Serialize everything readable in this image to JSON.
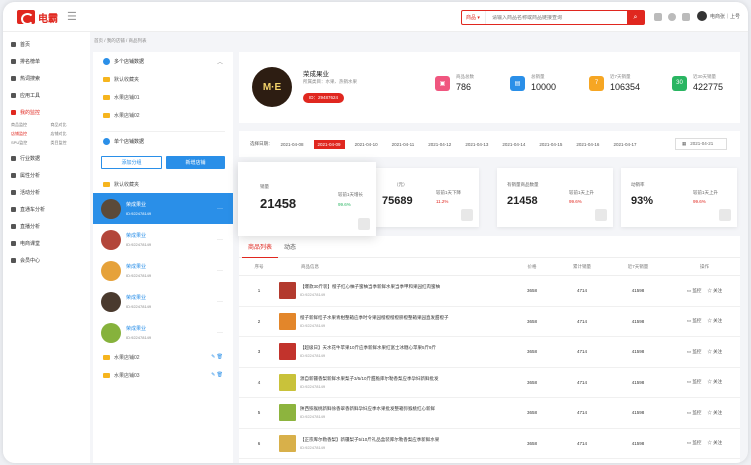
{
  "header": {
    "logo": "电霸",
    "menu_toggle": "☰",
    "search_category": "商品 ▾",
    "search_placeholder": "请输入商品名称或商品链接查询",
    "search_icon": "search-icon",
    "user_name": "电商张｜上号",
    "accent": "#e0271f"
  },
  "breadcrumb": "首页 / 我的店铺 / 商品列表",
  "sidebar": {
    "items": [
      {
        "label": "首页"
      },
      {
        "label": "排名榜单"
      },
      {
        "label": "热词搜索"
      },
      {
        "label": "应用工具"
      },
      {
        "label": "我的监控",
        "active": true
      }
    ],
    "sub": [
      "商品监控",
      "商品对比",
      "店铺监控",
      "店铺对比",
      "SPU监控",
      "类目监控"
    ],
    "items2": [
      {
        "label": "行业数据"
      },
      {
        "label": "属性分析"
      },
      {
        "label": "活动分析"
      },
      {
        "label": "直通车分析"
      },
      {
        "label": "直播分析"
      },
      {
        "label": "电商课堂"
      },
      {
        "label": "会员中心"
      }
    ]
  },
  "store_panel": {
    "group_multi": "多个店铺数据",
    "folders_top": [
      {
        "label": "默认收藏夹"
      },
      {
        "label": "水果店铺01"
      },
      {
        "label": "水果店铺02"
      }
    ],
    "group_single": "单个店铺数据",
    "btn_add_group": "添加分组",
    "btn_add_store": "新增店铺",
    "folder_default": "默认收藏夹",
    "stores": [
      {
        "name": "荣成果业",
        "id": "ID:922478149",
        "active": true
      },
      {
        "name": "荣成果业",
        "id": "ID:922478149"
      },
      {
        "name": "荣成果业",
        "id": "ID:922478149"
      },
      {
        "name": "荣成果业",
        "id": "ID:922478149"
      },
      {
        "name": "荣成果业",
        "id": "ID:922478149"
      }
    ],
    "folders_bottom": [
      {
        "label": "水果店铺02"
      },
      {
        "label": "水果店铺03"
      }
    ]
  },
  "shop": {
    "avatar_text": "M·E",
    "name": "荣成果业",
    "category": "所属类目：水果、热销水果",
    "id_badge": "ID：29487624",
    "kpis": [
      {
        "label": "商品总数",
        "value": "786",
        "color": "#f0567f",
        "icon": "cart-icon"
      },
      {
        "label": "总销量",
        "value": "10000",
        "color": "#2a8fe8",
        "icon": "chart-icon"
      },
      {
        "label": "近7天销量",
        "value": "106354",
        "color": "#f6a623",
        "icon": "seven-icon"
      },
      {
        "label": "近30天销量",
        "value": "422775",
        "color": "#2ab562",
        "icon": "thirty-icon"
      }
    ]
  },
  "datebar": {
    "label": "选择日期：",
    "dates": [
      "2021-04-08",
      "2021-04-09",
      "2021-04-10",
      "2021-04-11",
      "2021-04-12",
      "2021-04-13",
      "2021-04-14",
      "2021-04-15",
      "2021-04-16",
      "2021-04-17"
    ],
    "active_index": 1,
    "picker": "2021-04-21"
  },
  "stats": [
    {
      "label": "销量",
      "value": "21458",
      "cmp_label": "较前1天增长",
      "cmp_value": "99.6%",
      "cmp_color": "green"
    },
    {
      "label": "（元）",
      "value": "75689",
      "cmp_label": "较前1天下降",
      "cmp_value": "11.2%",
      "cmp_color": "red"
    },
    {
      "label": "有销量商品数量",
      "value": "21458",
      "cmp_label": "较前1天上升",
      "cmp_value": "99.6%",
      "cmp_color": "red"
    },
    {
      "label": "动销率",
      "value": "93%",
      "cmp_label": "较前1天上升",
      "cmp_value": "99.6%",
      "cmp_color": "red"
    }
  ],
  "tabs": [
    {
      "label": "商品列表",
      "active": true
    },
    {
      "label": "动态"
    }
  ],
  "table": {
    "headers": [
      "序号",
      "商品信息",
      "价格",
      "累计销量",
      "近7天销量",
      "操作"
    ],
    "rows": [
      {
        "no": "1",
        "name": "【爆款30斤装】橙子红心柚子蜜柚当季新鲜水果当季甲和果园红肉蜜柚",
        "id": "ID:922478149",
        "price": "3658",
        "total": "4714",
        "week": "41598",
        "thumb": "#b33a2e"
      },
      {
        "no": "2",
        "name": "橙子新鲜桔子水果青柑整箱应季时令果园橙橙橙橙脐橙整箱果园直发甜橙子",
        "id": "ID:922478149",
        "price": "3658",
        "total": "4714",
        "week": "41598",
        "thumb": "#e3862a"
      },
      {
        "no": "3",
        "name": "【超级日】天水花牛苹果10斤应季新鲜水果红富士冰糖心苹果5斤9斤",
        "id": "ID:922478149",
        "price": "3658",
        "total": "4714",
        "week": "41598",
        "thumb": "#c2332c"
      },
      {
        "no": "4",
        "name": "源自新疆香梨新鲜水果梨子3/5/10斤甜脆库尔勒香梨应季孕妇新鲜批发",
        "id": "ID:922478149",
        "price": "3658",
        "total": "4714",
        "week": "41598",
        "thumb": "#c9c23a"
      },
      {
        "no": "5",
        "name": "陕西猕猴桃新鲜徐香翠香新鲜孕妇应季水果批发整箱弥猴桃红心新鲜",
        "id": "ID:922478149",
        "price": "3658",
        "total": "4714",
        "week": "41598",
        "thumb": "#8db43e"
      },
      {
        "no": "6",
        "name": "【正宗库尔勒香梨】新疆梨子5/10斤礼品盒装库尔勒香梨应季新鲜水果",
        "id": "ID:922478149",
        "price": "3658",
        "total": "4714",
        "week": "41598",
        "thumb": "#d8b04a"
      }
    ],
    "op_monitor": "▭ 监控",
    "op_follow": "☆ 关注"
  }
}
